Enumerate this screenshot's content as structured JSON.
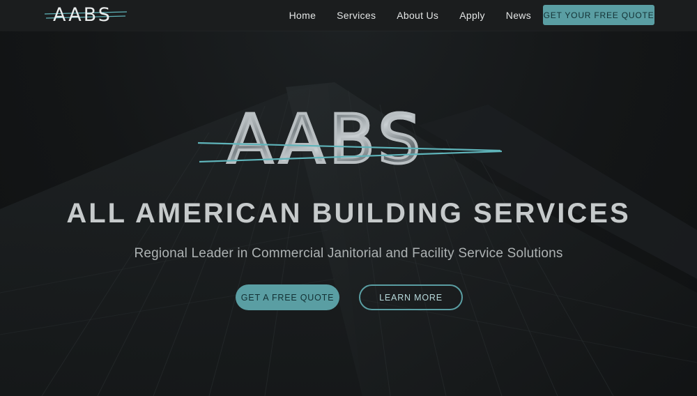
{
  "brand": {
    "nav_logo_text": "AABS",
    "hero_logo_text": "AABS",
    "accent_color": "#5a9ea3"
  },
  "nav": {
    "items": [
      {
        "label": "Home"
      },
      {
        "label": "Services"
      },
      {
        "label": "About Us"
      },
      {
        "label": "Apply"
      },
      {
        "label": "News"
      }
    ],
    "cta_label": "GET YOUR FREE QUOTE"
  },
  "hero": {
    "title": "ALL AMERICAN BUILDING SERVICES",
    "subtitle": "Regional Leader in Commercial Janitorial and Facility Service Solutions",
    "primary_button": "GET A FREE QUOTE",
    "secondary_button": "LEARN MORE",
    "background": "skyscraper-photo"
  }
}
